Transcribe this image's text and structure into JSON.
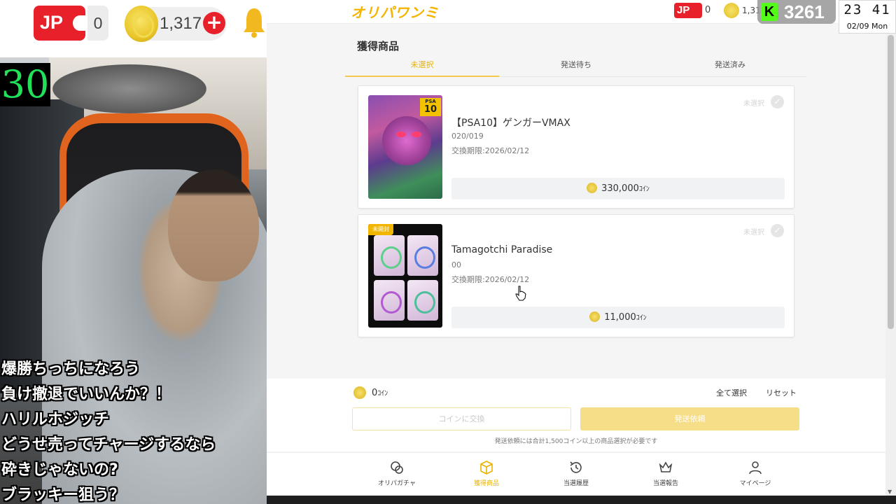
{
  "overlay": {
    "jp_label": "JP",
    "jp_count": "0",
    "coin_count": "1,317",
    "plus_label": "+",
    "counter": "30",
    "comments": [
      "爆勝ちっちになろう",
      "負け撤退でいいんか？！",
      "ハリルホジッチ",
      "どうせ売ってチャージするなら",
      "砕きじゃないの?",
      "ブラッキー狙う？"
    ],
    "kick_viewers": "3261",
    "clock_time": "23 41",
    "clock_date": "02/09 Mon"
  },
  "header": {
    "logo": "オリパワンミ",
    "jp_label": "JP",
    "jp_count": "0",
    "coin_count": "1,317"
  },
  "page": {
    "title": "獲得商品",
    "tabs": [
      {
        "label": "未選択",
        "active": true
      },
      {
        "label": "発送待ち",
        "active": false
      },
      {
        "label": "発送済み",
        "active": false
      }
    ]
  },
  "items": [
    {
      "title": "【PSA10】ゲンガーVMAX",
      "number": "020/019",
      "expiry": "交換期限:2026/02/12",
      "status": "未選択",
      "price": "330,000",
      "unit": "ｺｲﾝ",
      "psa_label": "PSA",
      "psa_grade": "10"
    },
    {
      "title": "Tamagotchi Paradise",
      "number": "00",
      "expiry": "交換期限:2026/02/12",
      "status": "未選択",
      "price": "11,000",
      "unit": "ｺｲﾝ",
      "tag": "未開封"
    }
  ],
  "bottom": {
    "coins": "0",
    "unit": "ｺｲﾝ",
    "select_all": "全て選択",
    "reset": "リセット",
    "exchange_label": "コインに交換",
    "ship_label": "発送依頼",
    "note": "発送依頼には合計1,500コイン以上の商品選択が必要です"
  },
  "nav": [
    {
      "label": "オリパガチャ",
      "icon": "gacha-icon"
    },
    {
      "label": "獲得商品",
      "icon": "box-icon",
      "active": true
    },
    {
      "label": "当選履歴",
      "icon": "history-icon"
    },
    {
      "label": "当選報告",
      "icon": "crown-icon"
    },
    {
      "label": "マイページ",
      "icon": "user-icon"
    }
  ],
  "colors": {
    "accent": "#f2c94c",
    "brand": "#f4b400",
    "jp_red": "#e8202a",
    "kick_green": "#53fc18"
  }
}
